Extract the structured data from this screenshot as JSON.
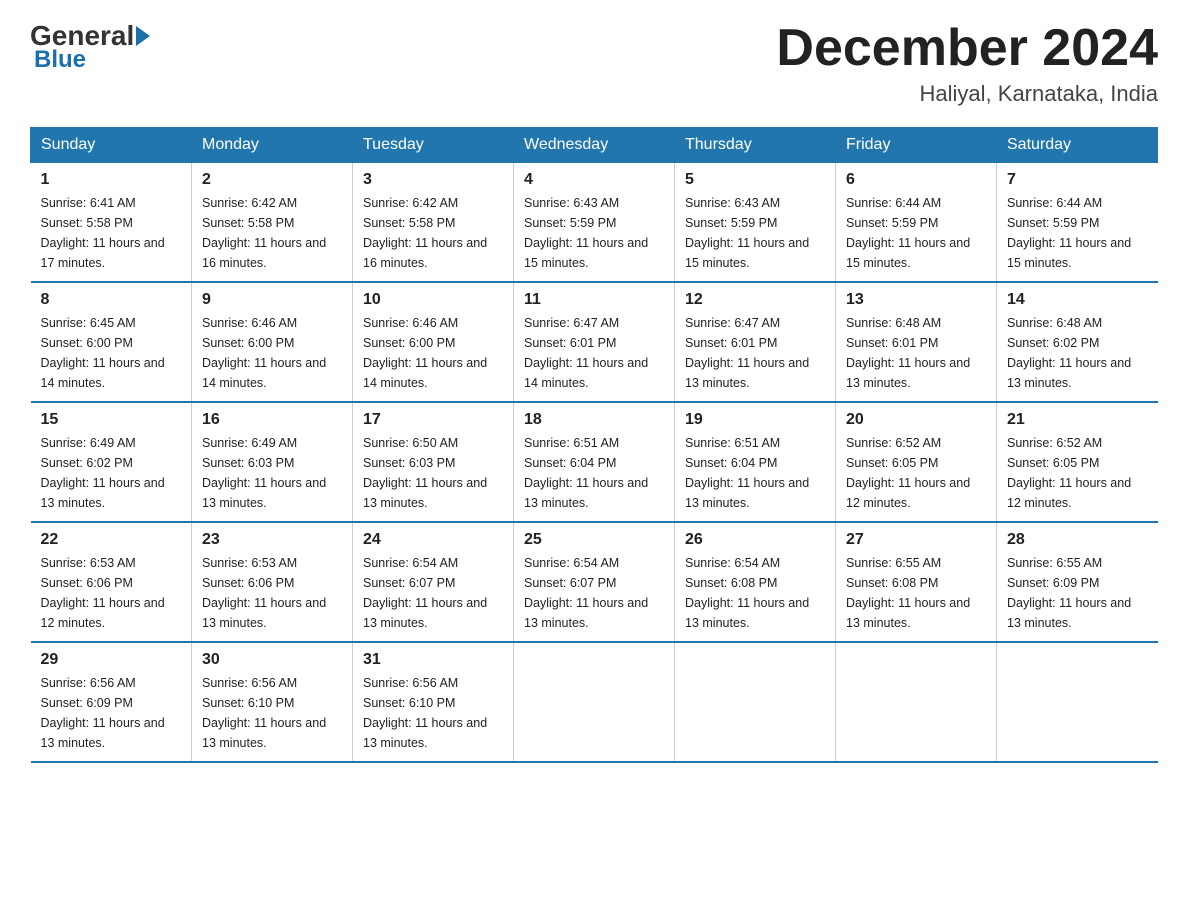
{
  "logo": {
    "general": "General",
    "blue": "Blue"
  },
  "title": "December 2024",
  "subtitle": "Haliyal, Karnataka, India",
  "days_of_week": [
    "Sunday",
    "Monday",
    "Tuesday",
    "Wednesday",
    "Thursday",
    "Friday",
    "Saturday"
  ],
  "weeks": [
    [
      {
        "day": "1",
        "sunrise": "6:41 AM",
        "sunset": "5:58 PM",
        "daylight": "11 hours and 17 minutes."
      },
      {
        "day": "2",
        "sunrise": "6:42 AM",
        "sunset": "5:58 PM",
        "daylight": "11 hours and 16 minutes."
      },
      {
        "day": "3",
        "sunrise": "6:42 AM",
        "sunset": "5:58 PM",
        "daylight": "11 hours and 16 minutes."
      },
      {
        "day": "4",
        "sunrise": "6:43 AM",
        "sunset": "5:59 PM",
        "daylight": "11 hours and 15 minutes."
      },
      {
        "day": "5",
        "sunrise": "6:43 AM",
        "sunset": "5:59 PM",
        "daylight": "11 hours and 15 minutes."
      },
      {
        "day": "6",
        "sunrise": "6:44 AM",
        "sunset": "5:59 PM",
        "daylight": "11 hours and 15 minutes."
      },
      {
        "day": "7",
        "sunrise": "6:44 AM",
        "sunset": "5:59 PM",
        "daylight": "11 hours and 15 minutes."
      }
    ],
    [
      {
        "day": "8",
        "sunrise": "6:45 AM",
        "sunset": "6:00 PM",
        "daylight": "11 hours and 14 minutes."
      },
      {
        "day": "9",
        "sunrise": "6:46 AM",
        "sunset": "6:00 PM",
        "daylight": "11 hours and 14 minutes."
      },
      {
        "day": "10",
        "sunrise": "6:46 AM",
        "sunset": "6:00 PM",
        "daylight": "11 hours and 14 minutes."
      },
      {
        "day": "11",
        "sunrise": "6:47 AM",
        "sunset": "6:01 PM",
        "daylight": "11 hours and 14 minutes."
      },
      {
        "day": "12",
        "sunrise": "6:47 AM",
        "sunset": "6:01 PM",
        "daylight": "11 hours and 13 minutes."
      },
      {
        "day": "13",
        "sunrise": "6:48 AM",
        "sunset": "6:01 PM",
        "daylight": "11 hours and 13 minutes."
      },
      {
        "day": "14",
        "sunrise": "6:48 AM",
        "sunset": "6:02 PM",
        "daylight": "11 hours and 13 minutes."
      }
    ],
    [
      {
        "day": "15",
        "sunrise": "6:49 AM",
        "sunset": "6:02 PM",
        "daylight": "11 hours and 13 minutes."
      },
      {
        "day": "16",
        "sunrise": "6:49 AM",
        "sunset": "6:03 PM",
        "daylight": "11 hours and 13 minutes."
      },
      {
        "day": "17",
        "sunrise": "6:50 AM",
        "sunset": "6:03 PM",
        "daylight": "11 hours and 13 minutes."
      },
      {
        "day": "18",
        "sunrise": "6:51 AM",
        "sunset": "6:04 PM",
        "daylight": "11 hours and 13 minutes."
      },
      {
        "day": "19",
        "sunrise": "6:51 AM",
        "sunset": "6:04 PM",
        "daylight": "11 hours and 13 minutes."
      },
      {
        "day": "20",
        "sunrise": "6:52 AM",
        "sunset": "6:05 PM",
        "daylight": "11 hours and 12 minutes."
      },
      {
        "day": "21",
        "sunrise": "6:52 AM",
        "sunset": "6:05 PM",
        "daylight": "11 hours and 12 minutes."
      }
    ],
    [
      {
        "day": "22",
        "sunrise": "6:53 AM",
        "sunset": "6:06 PM",
        "daylight": "11 hours and 12 minutes."
      },
      {
        "day": "23",
        "sunrise": "6:53 AM",
        "sunset": "6:06 PM",
        "daylight": "11 hours and 13 minutes."
      },
      {
        "day": "24",
        "sunrise": "6:54 AM",
        "sunset": "6:07 PM",
        "daylight": "11 hours and 13 minutes."
      },
      {
        "day": "25",
        "sunrise": "6:54 AM",
        "sunset": "6:07 PM",
        "daylight": "11 hours and 13 minutes."
      },
      {
        "day": "26",
        "sunrise": "6:54 AM",
        "sunset": "6:08 PM",
        "daylight": "11 hours and 13 minutes."
      },
      {
        "day": "27",
        "sunrise": "6:55 AM",
        "sunset": "6:08 PM",
        "daylight": "11 hours and 13 minutes."
      },
      {
        "day": "28",
        "sunrise": "6:55 AM",
        "sunset": "6:09 PM",
        "daylight": "11 hours and 13 minutes."
      }
    ],
    [
      {
        "day": "29",
        "sunrise": "6:56 AM",
        "sunset": "6:09 PM",
        "daylight": "11 hours and 13 minutes."
      },
      {
        "day": "30",
        "sunrise": "6:56 AM",
        "sunset": "6:10 PM",
        "daylight": "11 hours and 13 minutes."
      },
      {
        "day": "31",
        "sunrise": "6:56 AM",
        "sunset": "6:10 PM",
        "daylight": "11 hours and 13 minutes."
      },
      null,
      null,
      null,
      null
    ]
  ]
}
